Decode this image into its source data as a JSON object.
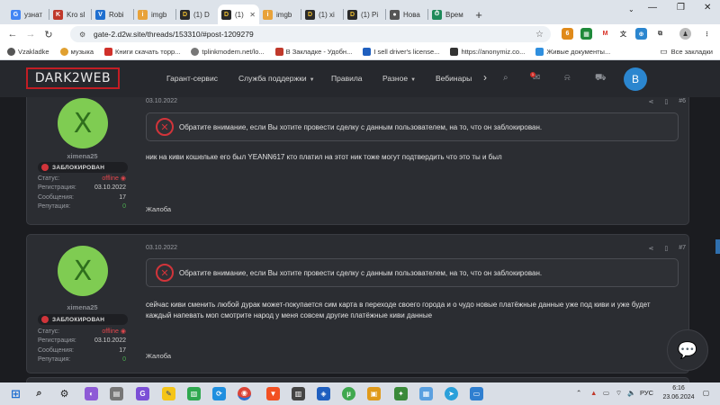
{
  "browser": {
    "tabs": [
      {
        "label": "узнат",
        "color": "#4285f4",
        "glyph": "G"
      },
      {
        "label": "Kro sl",
        "color": "#c0392b",
        "glyph": "K"
      },
      {
        "label": "Robi",
        "color": "#1f6fd0",
        "glyph": "V"
      },
      {
        "label": "imgb",
        "color": "#e8a23a",
        "glyph": "i"
      },
      {
        "label": "(1) D",
        "color": "#2a2a2a",
        "glyph": "D"
      },
      {
        "label": "(1) -",
        "color": "#2a2a2a",
        "glyph": "D",
        "active": true
      },
      {
        "label": "imgb",
        "color": "#e8a23a",
        "glyph": "i"
      },
      {
        "label": "(1) xi",
        "color": "#2a2a2a",
        "glyph": "D"
      },
      {
        "label": "(1) Pi",
        "color": "#2a2a2a",
        "glyph": "D"
      },
      {
        "label": "Нова",
        "color": "#555555",
        "glyph": "●"
      },
      {
        "label": "Врем",
        "color": "#1e8a5a",
        "glyph": "⏱"
      }
    ],
    "new_tab": "+",
    "url": "gate-2.d2w.site/threads/153310/#post-1209279",
    "bookmarks": [
      {
        "label": "Vzakladke",
        "color": "#555555"
      },
      {
        "label": "музыка",
        "color": "#e0a030"
      },
      {
        "label": "Книги скачать торр...",
        "color": "#d0302a"
      },
      {
        "label": "tplinkmodem.net/lo...",
        "color": "#777777"
      },
      {
        "label": "В Закладке - Удобн...",
        "color": "#c0392b"
      },
      {
        "label": "I sell driver's license...",
        "color": "#1f5fbf"
      },
      {
        "label": "https://anonymiz.co...",
        "color": "#333333"
      },
      {
        "label": "Живые документы...",
        "color": "#2f8fdf"
      }
    ],
    "all_bookmarks": "Все закладки"
  },
  "site": {
    "logo": "DARK2WEB",
    "nav": [
      {
        "label": "Гарант-сервис",
        "dropdown": false
      },
      {
        "label": "Служба поддержки",
        "dropdown": true
      },
      {
        "label": "Правила",
        "dropdown": false
      },
      {
        "label": "Разное",
        "dropdown": true
      },
      {
        "label": "Вебинары",
        "dropdown": false
      }
    ],
    "nav_more": "›",
    "avatar_letter": "B",
    "notif_badge": "1"
  },
  "posts": [
    {
      "avatar_letter": "X",
      "username": "ximena25",
      "banner": "ЗАБЛОКИРОВАН",
      "stats": [
        {
          "label": "Статус:",
          "value": "offline",
          "kind": "status"
        },
        {
          "label": "Регистрация:",
          "value": "03.10.2022",
          "kind": "normal"
        },
        {
          "label": "Сообщения:",
          "value": "17",
          "kind": "normal"
        },
        {
          "label": "Репутация:",
          "value": "0",
          "kind": "zero"
        }
      ],
      "date": "03.10.2022",
      "number": "#6",
      "notice": "Обратите внимание, если Вы хотите провести сделку с данным пользователем, на то, что он заблокирован.",
      "text": "ник на киви кошельке его был YEANN617 кто платил на этот ник тоже могут подтвердить что это ты и был",
      "report": "Жалоба"
    },
    {
      "avatar_letter": "X",
      "username": "ximena25",
      "banner": "ЗАБЛОКИРОВАН",
      "stats": [
        {
          "label": "Статус:",
          "value": "offline",
          "kind": "status"
        },
        {
          "label": "Регистрация:",
          "value": "03.10.2022",
          "kind": "normal"
        },
        {
          "label": "Сообщения:",
          "value": "17",
          "kind": "normal"
        },
        {
          "label": "Репутация:",
          "value": "0",
          "kind": "zero"
        }
      ],
      "date": "03.10.2022",
      "number": "#7",
      "notice": "Обратите внимание, если Вы хотите провести сделку с данным пользователем, на то, что он заблокирован.",
      "text": "сейчас киви сменить любой дурак может-покупается сим карта в переходе своего города и о чудо новые платёжные данные уже под киви и уже будет каждый напевать моп смотрите народ у меня совсем другие платёжные киви данные",
      "report": "Жалоба"
    }
  ],
  "taskbar": {
    "language": "РУС",
    "time": "6:16",
    "date": "23.06.2024"
  }
}
